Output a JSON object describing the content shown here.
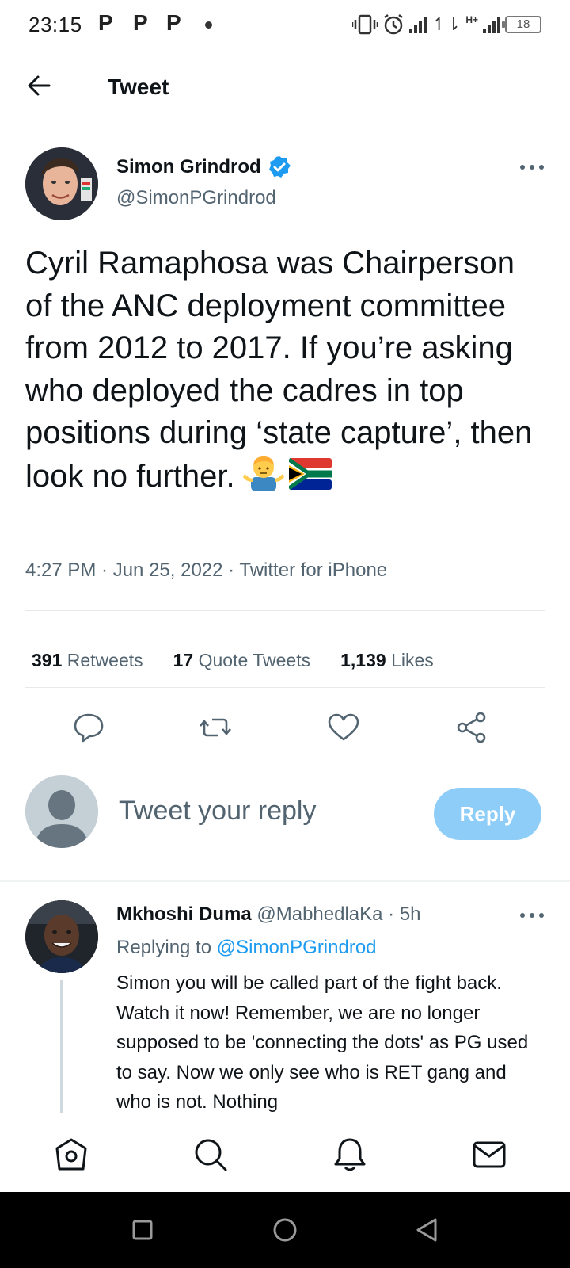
{
  "status_bar": {
    "time": "23:15",
    "p_icons": [
      "P",
      "P",
      "P"
    ],
    "network": "H+",
    "battery": "18"
  },
  "header": {
    "title": "Tweet"
  },
  "tweet": {
    "author_name": "Simon Grindrod",
    "author_handle": "@SimonPGrindrod",
    "text": "Cyril Ramaphosa was Chairperson of the ANC deployment committee from 2012 to 2017. If you’re asking who deployed the cadres in top positions during ‘state capture’, then look no further.",
    "meta": "4:27 PM · Jun 25, 2022 · Twitter for iPhone",
    "stats": {
      "retweets_count": "391",
      "retweets_label": "Retweets",
      "quotes_count": "17",
      "quotes_label": "Quote Tweets",
      "likes_count": "1,139",
      "likes_label": "Likes"
    }
  },
  "reply_composer": {
    "placeholder": "Tweet your reply",
    "button_label": "Reply"
  },
  "reply": {
    "name": "Mkhoshi Duma",
    "handle": "@MabhedlaKa",
    "time": "· 5h",
    "replying_prefix": "Replying to",
    "replying_to": "@SimonPGrindrod",
    "text": "Simon you will be called part of the fight back. Watch it now! Remember, we are no longer supposed to be 'connecting the dots' as PG used to say. Now we only see who is RET gang and who is not. Nothing"
  },
  "colors": {
    "accent": "#1d9bf0",
    "reply_button": "#8ecdf8",
    "secondary_text": "#536471"
  },
  "icons": {
    "actions": [
      "comment-icon",
      "retweet-icon",
      "like-icon",
      "share-icon"
    ],
    "bottom_nav": [
      "home-icon",
      "search-icon",
      "notifications-icon",
      "messages-icon"
    ],
    "system_nav": [
      "recents-icon",
      "home-circle-icon",
      "back-triangle-icon"
    ]
  }
}
